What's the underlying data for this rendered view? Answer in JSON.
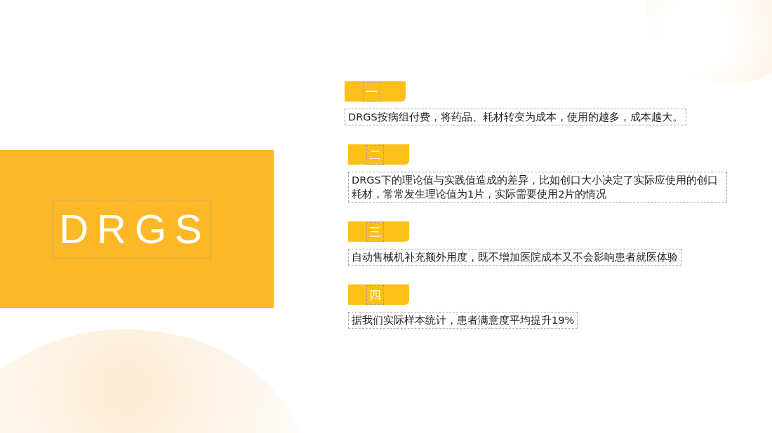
{
  "title_panel": {
    "title": "DRGS"
  },
  "points": [
    {
      "number": "一",
      "text": "DRGS按病组付费，将药品、耗材转变为成本，使用的越多，成本越大。"
    },
    {
      "number": "二",
      "text": "DRGS下的理论值与实践值造成的差异，比如创口大小决定了实际应使用的创口耗材，常常发生理论值为1片，实际需要使用2片的情况"
    },
    {
      "number": "三",
      "text": "自动售械机补充额外用度，既不增加医院成本又不会影响患者就医体验"
    },
    {
      "number": "四",
      "text": "据我们实际样本统计，患者满意度平均提升19%"
    }
  ]
}
